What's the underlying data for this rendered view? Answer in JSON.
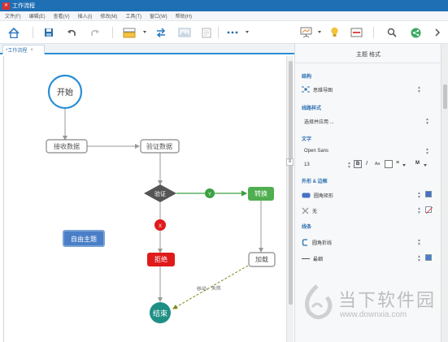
{
  "window": {
    "title": "工作流程"
  },
  "menu": [
    "文件(F)",
    "编辑(E)",
    "查看(V)",
    "插入(I)",
    "修改(M)",
    "工具(T)",
    "窗口(W)",
    "帮助(H)"
  ],
  "toolbar_icons": [
    "home-icon",
    "save-icon",
    "undo-icon",
    "redo-icon",
    "layout-icon",
    "swap-icon",
    "image-icon",
    "page-icon",
    "more-icon",
    "presentation-icon",
    "lightbulb-icon",
    "layout-panel-icon",
    "search-icon",
    "share-icon",
    "chevron-right-icon"
  ],
  "tab": {
    "label": "*工作流程",
    "close": "×"
  },
  "diagram": {
    "start": "开始",
    "collect": "接收数据",
    "validate": "验证数据",
    "decision": "验证",
    "yes_badge": "Y",
    "no_badge": "X",
    "convert": "转换",
    "reject": "拒绝",
    "load": "加载",
    "end": "结束",
    "free_topic": "自由主题",
    "dashed_label": "移动、失败"
  },
  "panel": {
    "title": "主题 格式",
    "structure_label": "结构",
    "structure_value": "思维导图",
    "branch_style_label": "线路样式",
    "branch_style_value": "选择并应用 ...",
    "text_label": "文字",
    "font_value": "Open Sans",
    "font_size": "13",
    "bold": "B",
    "italic": "I",
    "case": "Aa",
    "align": "≡",
    "more": "M",
    "shape_border_label": "外形 & 边框",
    "shape_value": "圆角矩形",
    "fill_value": "无",
    "line_label": "线条",
    "line_shape_value": "圆角折线",
    "line_width_value": "最细"
  },
  "colors": {
    "shape_color": "#4472c4",
    "line_color": "#4a7fc8",
    "accent": "#2b8ed6"
  },
  "watermark": {
    "text": "当下软件园",
    "url": "www.downxia.com"
  }
}
